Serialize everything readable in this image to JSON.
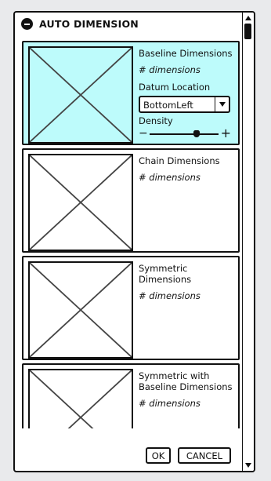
{
  "window": {
    "title": "AUTO DIMENSION",
    "close_icon": "minus-circle-icon"
  },
  "items": [
    {
      "title": "Baseline Dimensions",
      "count_label": "# dimensions",
      "selected": true
    },
    {
      "title": "Chain Dimensions",
      "count_label": "# dimensions",
      "selected": false
    },
    {
      "title": "Symmetric Dimensions",
      "count_label": "# dimensions",
      "selected": false
    },
    {
      "title": "Symmetric with Baseline Dimensions",
      "count_label": "# dimensions",
      "selected": false
    }
  ],
  "datum": {
    "label": "Datum Location",
    "value": "BottomLeft"
  },
  "density": {
    "label": "Density",
    "minus": "−",
    "plus": "+",
    "level": 0.68
  },
  "buttons": {
    "ok": "OK",
    "cancel": "CANCEL"
  },
  "colors": {
    "selected_item": "#bdfbfb",
    "stroke": "#111111"
  }
}
